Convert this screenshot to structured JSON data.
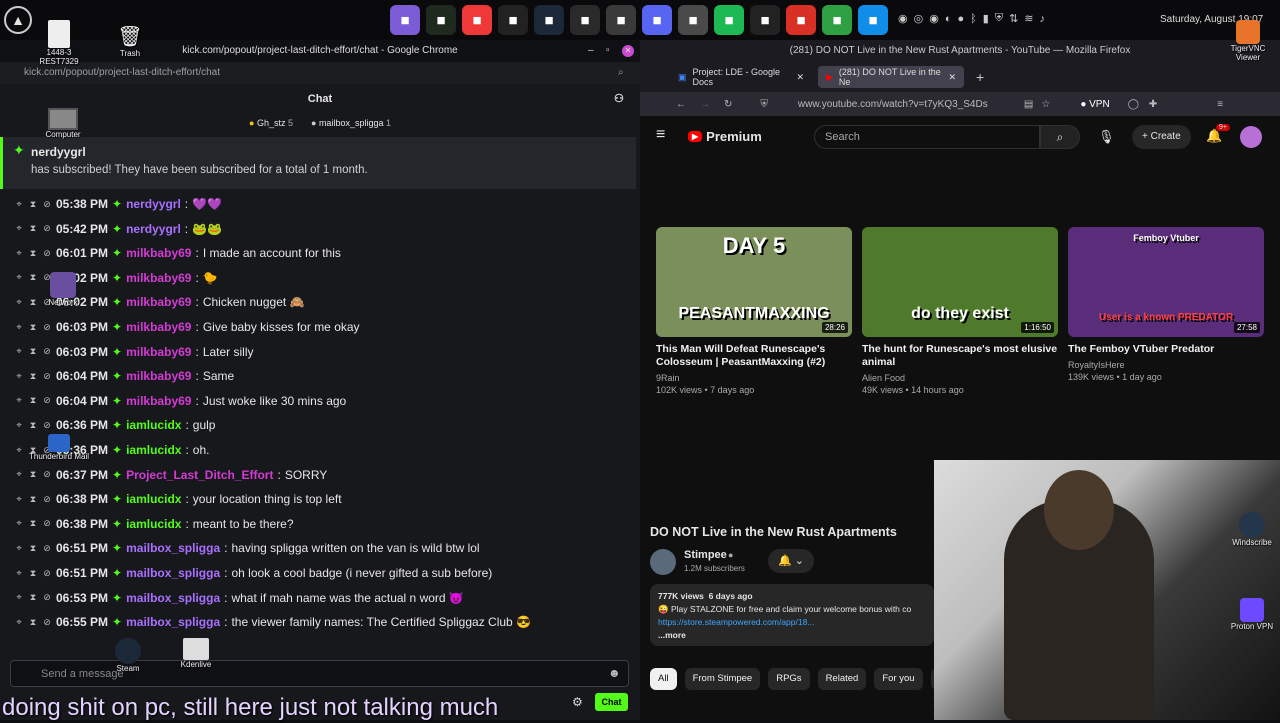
{
  "top_panel": {
    "apps": [
      {
        "icon": "folder-icon",
        "color": "#7b5cd6"
      },
      {
        "icon": "monitor-icon",
        "color": "#1f2a1f"
      },
      {
        "icon": "vivaldi-icon",
        "color": "#ef3939"
      },
      {
        "icon": "terminal-icon",
        "color": "#222"
      },
      {
        "icon": "steam-icon",
        "color": "#1b2838"
      },
      {
        "icon": "gamepad-icon",
        "color": "#2a2a2a"
      },
      {
        "icon": "wordpress-icon",
        "color": "#3a3a3a"
      },
      {
        "icon": "discord-icon",
        "color": "#5865f2"
      },
      {
        "icon": "mail-icon",
        "color": "#4a4a4a"
      },
      {
        "icon": "spotify-icon",
        "color": "#1db954"
      },
      {
        "icon": "obs-icon",
        "color": "#222"
      },
      {
        "icon": "chrome-icon",
        "color": "#d93025"
      },
      {
        "icon": "shield-icon",
        "color": "#2ea043"
      },
      {
        "icon": "teamviewer-icon",
        "color": "#0e8ee9"
      }
    ],
    "clock": "Saturday, August 19:07"
  },
  "desktop_icons": [
    {
      "label": "1448-3 REST7329",
      "name": "file"
    },
    {
      "label": "Trash",
      "name": "trash"
    },
    {
      "label": "Computer",
      "name": "computer"
    },
    {
      "label": "Network",
      "name": "network"
    },
    {
      "label": "Thunderbird Mail",
      "name": "thunderbird"
    },
    {
      "label": "Steam",
      "name": "steam"
    },
    {
      "label": "Kdenlive",
      "name": "kdenlive"
    },
    {
      "label": "TigerVNC Viewer",
      "name": "tigervnc"
    },
    {
      "label": "Windscribe",
      "name": "windscribe"
    },
    {
      "label": "Proton VPN",
      "name": "protonvpn"
    }
  ],
  "chat": {
    "window_title": "kick.com/popout/project-last-ditch-effort/chat - Google Chrome",
    "url": "kick.com/popout/project-last-ditch-effort/chat",
    "header": "Chat",
    "gifters": [
      {
        "name": "Gh_stz",
        "count": "5"
      },
      {
        "name": "mailbox_spligga",
        "count": "1"
      }
    ],
    "sub_card": {
      "user": "nerdyygrl",
      "text": "has subscribed! They have been subscribed for a total of 1 month."
    },
    "messages": [
      {
        "time": "05:38 PM",
        "user": "nerdyygrl",
        "color": "#a970ff",
        "text": "💜💜"
      },
      {
        "time": "05:42 PM",
        "user": "nerdyygrl",
        "color": "#a970ff",
        "text": "🐸🐸"
      },
      {
        "time": "06:01 PM",
        "user": "milkbaby69",
        "color": "#d43bd4",
        "text": "I made an account for this"
      },
      {
        "time": "06:02 PM",
        "user": "milkbaby69",
        "color": "#d43bd4",
        "text": "🐤"
      },
      {
        "time": "06:02 PM",
        "user": "milkbaby69",
        "color": "#d43bd4",
        "text": "Chicken nugget 🙈"
      },
      {
        "time": "06:03 PM",
        "user": "milkbaby69",
        "color": "#d43bd4",
        "text": "Give baby kisses for me okay"
      },
      {
        "time": "06:03 PM",
        "user": "milkbaby69",
        "color": "#d43bd4",
        "text": "Later silly"
      },
      {
        "time": "06:04 PM",
        "user": "milkbaby69",
        "color": "#d43bd4",
        "text": "Same"
      },
      {
        "time": "06:04 PM",
        "user": "milkbaby69",
        "color": "#d43bd4",
        "text": "Just woke like 30 mins ago"
      },
      {
        "time": "06:36 PM",
        "user": "iamlucidx",
        "color": "#53fc18",
        "text": "gulp"
      },
      {
        "time": "06:36 PM",
        "user": "iamlucidx",
        "color": "#53fc18",
        "text": "oh."
      },
      {
        "time": "06:37 PM",
        "user": "Project_Last_Ditch_Effort",
        "color": "#d43bd4",
        "text": "SORRY"
      },
      {
        "time": "06:38 PM",
        "user": "iamlucidx",
        "color": "#53fc18",
        "text": "your location thing is top left"
      },
      {
        "time": "06:38 PM",
        "user": "iamlucidx",
        "color": "#53fc18",
        "text": "meant to be there?"
      },
      {
        "time": "06:51 PM",
        "user": "mailbox_spligga",
        "color": "#a970ff",
        "text": "having spligga written on the van is wild btw lol"
      },
      {
        "time": "06:51 PM",
        "user": "mailbox_spligga",
        "color": "#a970ff",
        "text": "oh look a cool badge (i never gifted a sub before)"
      },
      {
        "time": "06:53 PM",
        "user": "mailbox_spligga",
        "color": "#a970ff",
        "text": "what if mah name was the actual n word 😈"
      },
      {
        "time": "06:55 PM",
        "user": "mailbox_spligga",
        "color": "#a970ff",
        "text": "the viewer family names: The Certified Spliggaz Club 😎"
      }
    ],
    "input_placeholder": "Send a message",
    "send_label": "Chat",
    "caption": "doing shit on pc, still here just not talking much"
  },
  "firefox": {
    "window_title": "(281) DO NOT Live in the New Rust Apartments - YouTube — Mozilla Firefox",
    "tabs": [
      {
        "label": "Project: LDE - Google Docs",
        "active": false
      },
      {
        "label": "(281) DO NOT Live in the Ne",
        "active": true
      }
    ],
    "url": "www.youtube.com/watch?v=t7yKQ3_S4Ds",
    "vpn": "VPN"
  },
  "youtube": {
    "logo": "Premium",
    "search_placeholder": "Search",
    "create": "Create",
    "notif_count": "9+",
    "recommended": [
      {
        "thumb_text": "DAY 5",
        "thumb_sub": "PEASANTMAXXING",
        "duration": "28:26",
        "title": "This Man Will Defeat Runescape's Colosseum | PeasantMaxxing (#2)",
        "channel": "9Rain",
        "meta": "102K views • 7 days ago",
        "bg": "#7a8f5a"
      },
      {
        "thumb_text": "",
        "thumb_sub": "do they exist",
        "duration": "1:16:50",
        "title": "The hunt for Runescape's most elusive animal",
        "channel": "Alien Food",
        "meta": "49K views • 14 hours ago",
        "bg": "#4f7a2c"
      },
      {
        "thumb_text": "Femboy Vtuber",
        "thumb_sub": "User is a known PREDATOR",
        "duration": "27:58",
        "title": "The Femboy VTuber Predator",
        "channel": "RoyaltyIsHere",
        "meta": "139K views • 1 day ago",
        "bg": "#5a2d7a"
      }
    ],
    "video_title": "DO NOT Live in the New Rust Apartments",
    "channel_name": "Stimpee",
    "subscribers": "1.2M subscribers",
    "views": "777K views",
    "posted": "6 days ago",
    "desc_line": "😜 Play STALZONE for free and claim your welcome bonus with co",
    "desc_link": "https://store.steampowered.com/app/18...",
    "more": "...more",
    "chips": [
      "All",
      "From Stimpee",
      "RPGs",
      "Related",
      "For you",
      "Rec"
    ]
  }
}
